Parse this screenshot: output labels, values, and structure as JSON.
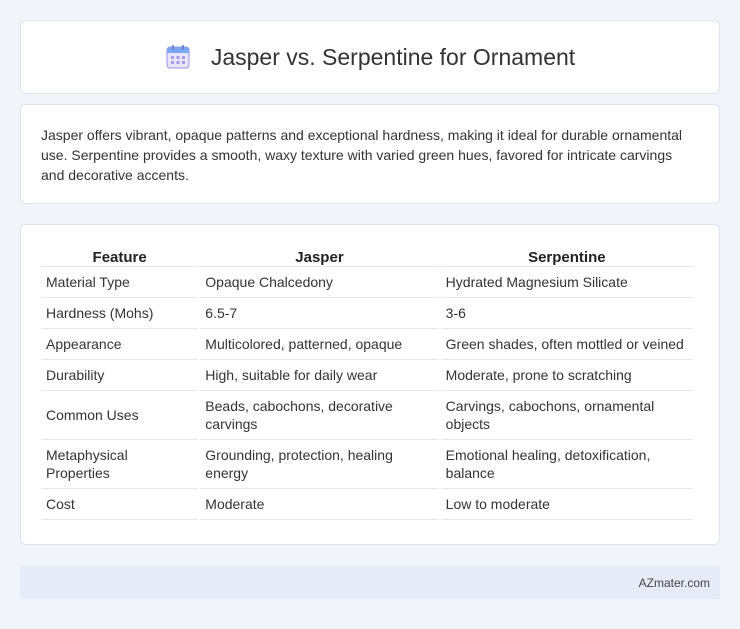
{
  "header": {
    "title": "Jasper vs. Serpentine for Ornament",
    "icon": "calendar-icon"
  },
  "summary": {
    "text": "Jasper offers vibrant, opaque patterns and exceptional hardness, making it ideal for durable ornamental use. Serpentine provides a smooth, waxy texture with varied green hues, favored for intricate carvings and decorative accents."
  },
  "table": {
    "headers": [
      "Feature",
      "Jasper",
      "Serpentine"
    ],
    "rows": [
      [
        "Material Type",
        "Opaque Chalcedony",
        "Hydrated Magnesium Silicate"
      ],
      [
        "Hardness (Mohs)",
        "6.5-7",
        "3-6"
      ],
      [
        "Appearance",
        "Multicolored, patterned, opaque",
        "Green shades, often mottled or veined"
      ],
      [
        "Durability",
        "High, suitable for daily wear",
        "Moderate, prone to scratching"
      ],
      [
        "Common Uses",
        "Beads, cabochons, decorative carvings",
        "Carvings, cabochons, ornamental objects"
      ],
      [
        "Metaphysical Properties",
        "Grounding, protection, healing energy",
        "Emotional healing, detoxification, balance"
      ],
      [
        "Cost",
        "Moderate",
        "Low to moderate"
      ]
    ]
  },
  "footer": {
    "text": "AZmater.com"
  }
}
